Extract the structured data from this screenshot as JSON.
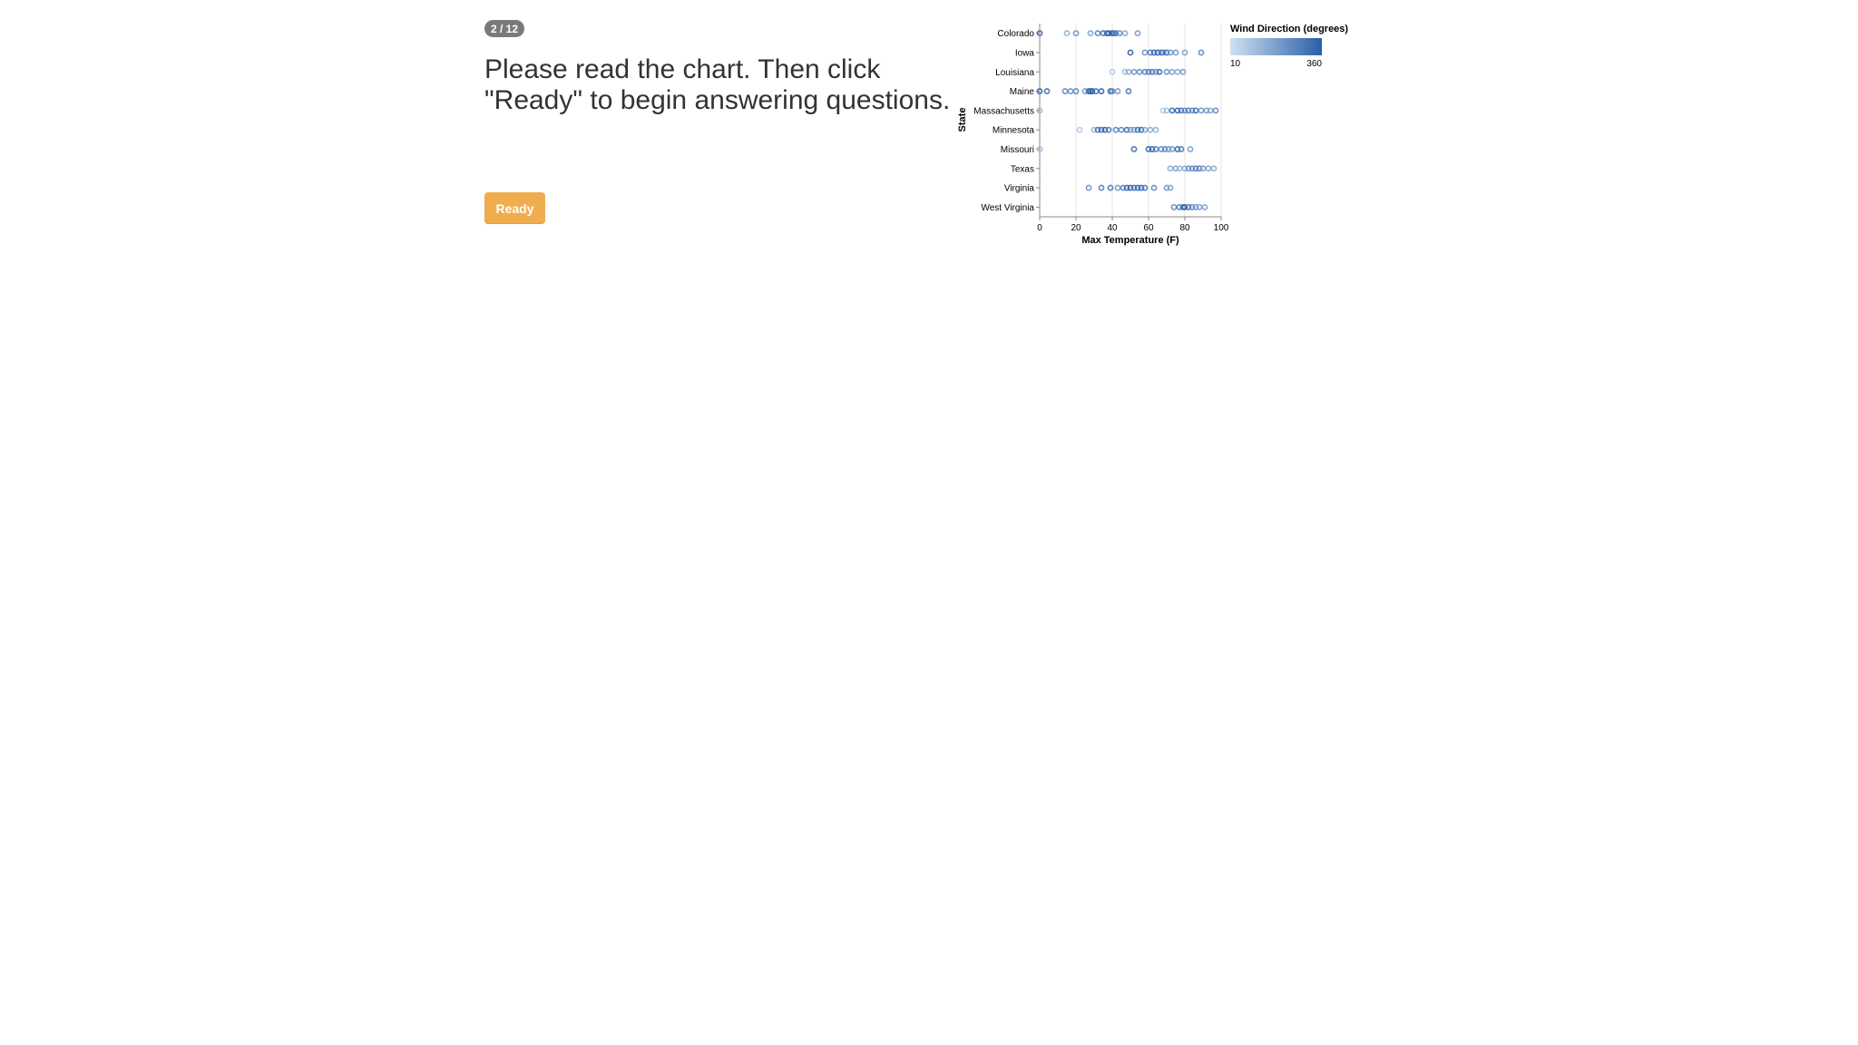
{
  "progress": {
    "label": "2 / 12",
    "current": 2,
    "total": 12
  },
  "instructions": {
    "line1": "Please read the chart. Then click",
    "line2": "\"Ready\" to begin answering questions."
  },
  "ready_button": {
    "label": "Ready"
  },
  "colors": {
    "ready_button": "#f0ad4e",
    "progress_badge": "#7a7a7a",
    "scale_low": "#cfe1f2",
    "scale_high": "#2a5ea8"
  },
  "chart_data": {
    "type": "scatter",
    "mark": "open-circle",
    "xlabel": "Max Temperature (F)",
    "ylabel": "State",
    "xlim": [
      0,
      100
    ],
    "x_ticks": [
      "0",
      "20",
      "40",
      "60",
      "80",
      "100"
    ],
    "grid": true,
    "legend": {
      "title": "Wind Direction (degrees)",
      "type": "color-gradient",
      "min_label": "10",
      "max_label": "360",
      "min": 10,
      "max": 360,
      "placement": "top-right"
    },
    "categories": [
      "Colorado",
      "Iowa",
      "Louisiana",
      "Maine",
      "Massachusetts",
      "Minnesota",
      "Missouri",
      "Texas",
      "Virginia",
      "West Virginia"
    ],
    "series": [
      {
        "category": "Colorado",
        "points": [
          [
            0,
            300
          ],
          [
            15,
            120
          ],
          [
            20,
            200
          ],
          [
            28,
            160
          ],
          [
            32,
            240
          ],
          [
            35,
            280
          ],
          [
            37,
            300
          ],
          [
            38,
            330
          ],
          [
            40,
            340
          ],
          [
            41,
            310
          ],
          [
            42,
            270
          ],
          [
            44,
            220
          ],
          [
            47,
            150
          ],
          [
            54,
            180
          ]
        ]
      },
      {
        "category": "Iowa",
        "points": [
          [
            50,
            320
          ],
          [
            58,
            200
          ],
          [
            61,
            260
          ],
          [
            63,
            300
          ],
          [
            65,
            330
          ],
          [
            67,
            280
          ],
          [
            68,
            250
          ],
          [
            70,
            310
          ],
          [
            72,
            200
          ],
          [
            75,
            180
          ],
          [
            80,
            160
          ],
          [
            89,
            220
          ]
        ]
      },
      {
        "category": "Louisiana",
        "points": [
          [
            40,
            60
          ],
          [
            47,
            100
          ],
          [
            49,
            140
          ],
          [
            52,
            180
          ],
          [
            55,
            210
          ],
          [
            58,
            240
          ],
          [
            60,
            260
          ],
          [
            62,
            280
          ],
          [
            64,
            220
          ],
          [
            66,
            300
          ],
          [
            70,
            200
          ],
          [
            73,
            160
          ],
          [
            76,
            140
          ],
          [
            79,
            180
          ]
        ]
      },
      {
        "category": "Maine",
        "points": [
          [
            0,
            320
          ],
          [
            4,
            280
          ],
          [
            14,
            220
          ],
          [
            17,
            200
          ],
          [
            20,
            240
          ],
          [
            25,
            180
          ],
          [
            27,
            300
          ],
          [
            28,
            330
          ],
          [
            29,
            350
          ],
          [
            31,
            270
          ],
          [
            34,
            310
          ],
          [
            39,
            300
          ],
          [
            40,
            240
          ],
          [
            43,
            180
          ],
          [
            49,
            260
          ]
        ]
      },
      {
        "category": "Massachusetts",
        "points": [
          [
            0,
            120
          ],
          [
            68,
            60
          ],
          [
            70,
            90
          ],
          [
            73,
            300
          ],
          [
            76,
            330
          ],
          [
            78,
            280
          ],
          [
            80,
            240
          ],
          [
            82,
            260
          ],
          [
            84,
            220
          ],
          [
            86,
            300
          ],
          [
            89,
            200
          ],
          [
            92,
            180
          ],
          [
            94,
            160
          ],
          [
            97,
            220
          ]
        ]
      },
      {
        "category": "Minnesota",
        "points": [
          [
            22,
            60
          ],
          [
            30,
            120
          ],
          [
            32,
            280
          ],
          [
            34,
            300
          ],
          [
            36,
            330
          ],
          [
            38,
            260
          ],
          [
            42,
            240
          ],
          [
            45,
            220
          ],
          [
            48,
            300
          ],
          [
            50,
            200
          ],
          [
            52,
            180
          ],
          [
            54,
            280
          ],
          [
            56,
            320
          ],
          [
            58,
            160
          ],
          [
            61,
            140
          ],
          [
            64,
            120
          ]
        ]
      },
      {
        "category": "Missouri",
        "points": [
          [
            0,
            100
          ],
          [
            52,
            280
          ],
          [
            60,
            300
          ],
          [
            62,
            320
          ],
          [
            64,
            260
          ],
          [
            67,
            220
          ],
          [
            69,
            240
          ],
          [
            71,
            200
          ],
          [
            73,
            180
          ],
          [
            76,
            300
          ],
          [
            78,
            260
          ],
          [
            83,
            160
          ]
        ]
      },
      {
        "category": "Texas",
        "points": [
          [
            72,
            140
          ],
          [
            75,
            160
          ],
          [
            77,
            120
          ],
          [
            80,
            140
          ],
          [
            82,
            200
          ],
          [
            84,
            220
          ],
          [
            86,
            240
          ],
          [
            88,
            260
          ],
          [
            90,
            180
          ],
          [
            93,
            160
          ],
          [
            96,
            140
          ]
        ]
      },
      {
        "category": "Virginia",
        "points": [
          [
            27,
            200
          ],
          [
            34,
            240
          ],
          [
            39,
            260
          ],
          [
            43,
            180
          ],
          [
            46,
            220
          ],
          [
            48,
            300
          ],
          [
            50,
            330
          ],
          [
            52,
            280
          ],
          [
            54,
            300
          ],
          [
            56,
            320
          ],
          [
            58,
            260
          ],
          [
            63,
            220
          ],
          [
            70,
            180
          ],
          [
            72,
            160
          ]
        ]
      },
      {
        "category": "West Virginia",
        "points": [
          [
            74,
            220
          ],
          [
            77,
            260
          ],
          [
            79,
            300
          ],
          [
            80,
            330
          ],
          [
            82,
            280
          ],
          [
            84,
            240
          ],
          [
            86,
            200
          ],
          [
            88,
            180
          ],
          [
            91,
            160
          ]
        ]
      }
    ]
  }
}
